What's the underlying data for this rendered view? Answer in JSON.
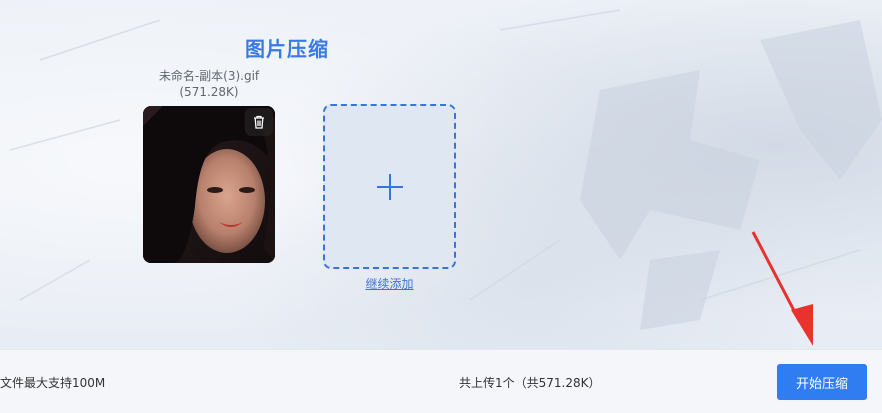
{
  "page": {
    "title": "图片压缩"
  },
  "file": {
    "name": "未命名-副本(3).gif",
    "size": "(571.28K)",
    "delete_icon": "trash-icon"
  },
  "add": {
    "icon": "plus-icon",
    "label": "继续添加"
  },
  "footer": {
    "limit_text": "文件最大支持100M",
    "summary_text": "共上传1个（共571.28K）",
    "start_label": "开始压缩"
  },
  "colors": {
    "accent": "#2f7df0",
    "title": "#3a7ae6",
    "arrow": "#e8322f"
  }
}
